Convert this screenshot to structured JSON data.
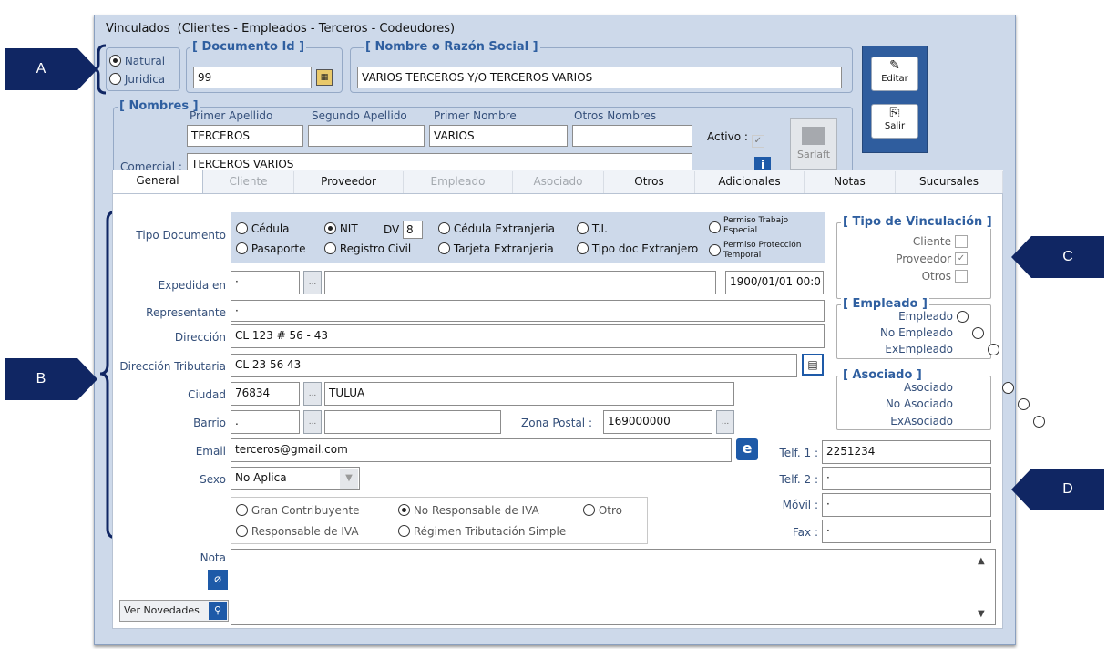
{
  "window": {
    "title": "Vinculados",
    "subtitle": "(Clientes - Empleados - Terceros - Codeudores)"
  },
  "person_type": {
    "natural": "Natural",
    "juridica": "Juridica",
    "selected": "Natural"
  },
  "documento": {
    "label": "[ Documento Id ]",
    "value": "99"
  },
  "nombre_razon": {
    "label": "[ Nombre o Razón Social ]",
    "value": "VARIOS TERCEROS Y/O TERCEROS VARIOS"
  },
  "buttons": {
    "editar": "Editar",
    "salir": "Salir",
    "sarlaft": "Sarlaft",
    "ver_novedades": "Ver Novedades"
  },
  "nombres": {
    "label": "[ Nombres ]",
    "primer_apellido_label": "Primer Apellido",
    "segundo_apellido_label": "Segundo Apellido",
    "primer_nombre_label": "Primer Nombre",
    "otros_nombres_label": "Otros Nombres",
    "primer_apellido": "TERCEROS",
    "segundo_apellido": "",
    "primer_nombre": "VARIOS",
    "otros_nombres": "",
    "comercial_label": "Comercial :",
    "comercial": "TERCEROS VARIOS",
    "activo_label": "Activo :"
  },
  "tabs": [
    {
      "label": "General",
      "state": "active"
    },
    {
      "label": "Cliente",
      "state": "disabled"
    },
    {
      "label": "Proveedor",
      "state": "enabled"
    },
    {
      "label": "Empleado",
      "state": "disabled"
    },
    {
      "label": "Asociado",
      "state": "disabled"
    },
    {
      "label": "Otros",
      "state": "enabled"
    },
    {
      "label": "Adicionales",
      "state": "enabled"
    },
    {
      "label": "Notas",
      "state": "enabled"
    },
    {
      "label": "Sucursales",
      "state": "enabled"
    }
  ],
  "tipo_documento": {
    "label": "Tipo Documento",
    "options": [
      "Cédula",
      "NIT",
      "Cédula Extranjeria",
      "T.I.",
      "Permiso Trabajo Especial",
      "Pasaporte",
      "Registro Civil",
      "Tarjeta Extranjeria",
      "Tipo doc Extranjero",
      "Permiso Protección Temporal"
    ],
    "selected": "NIT",
    "dv_label": "DV",
    "dv": "8"
  },
  "fields": {
    "expedida_label": "Expedida en",
    "expedida_code": "·",
    "expedida_name": "",
    "fecha": "1900/01/01 00:0",
    "representante_label": "Representante",
    "representante": "·",
    "direccion_label": "Dirección",
    "direccion": "CL 123 # 56 - 43",
    "direccion_trib_label": "Dirección Tributaria",
    "direccion_trib": "CL 23 56 43",
    "ciudad_label": "Ciudad",
    "ciudad_code": "76834",
    "ciudad_name": "TULUA",
    "barrio_label": "Barrio",
    "barrio_code": ".",
    "barrio_name": "",
    "zona_label": "Zona Postal :",
    "zona": "169000000",
    "email_label": "Email",
    "email": "terceros@gmail.com",
    "sexo_label": "Sexo",
    "sexo": "No Aplica",
    "telf1_label": "Telf. 1 :",
    "telf1": "2251234",
    "telf2_label": "Telf. 2 :",
    "telf2": "·",
    "movil_label": "Móvil :",
    "movil": "·",
    "fax_label": "Fax :",
    "fax": "·",
    "nota_label": "Nota",
    "nota": ""
  },
  "regimen": {
    "options": [
      "Gran Contribuyente",
      "No Responsable de IVA",
      "Otro",
      "Responsable de IVA",
      "Régimen Tributación Simple"
    ],
    "selected": "No Responsable de IVA"
  },
  "vinculacion": {
    "label": "[ Tipo de Vinculación ]",
    "cliente": "Cliente",
    "proveedor": "Proveedor",
    "otros": "Otros"
  },
  "empleado": {
    "label": "[ Empleado ]",
    "options": [
      "Empleado",
      "No Empleado",
      "ExEmpleado"
    ]
  },
  "asociado": {
    "label": "[ Asociado ]",
    "options": [
      "Asociado",
      "No Asociado",
      "ExAsociado"
    ]
  },
  "callouts": {
    "a": "A",
    "b": "B",
    "c": "C",
    "d": "D"
  },
  "colors": {
    "callout": "#102663",
    "window_bg": "#cdd9ea",
    "group_title": "#2f5fa0"
  }
}
